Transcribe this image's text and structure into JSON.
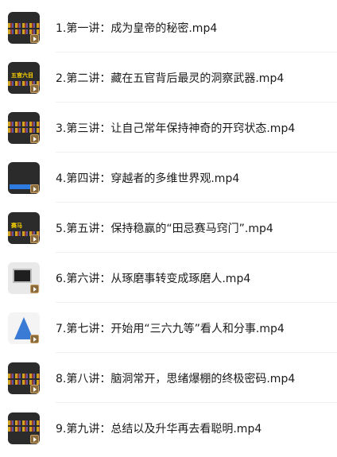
{
  "files": [
    {
      "name": "1.第一讲：成为皇帝的秘密.mp4",
      "thumb_icon": "video-thumbnail-icon",
      "thumb_caption": ""
    },
    {
      "name": "2.第二讲：藏在五官背后最灵的洞察武器.mp4",
      "thumb_icon": "video-thumbnail-icon",
      "thumb_caption": "五官六目"
    },
    {
      "name": "3.第三讲：让自己常年保持神奇的开窍状态.mp4",
      "thumb_icon": "video-thumbnail-icon",
      "thumb_caption": ""
    },
    {
      "name": "4.第四讲：穿越者的多维世界观.mp4",
      "thumb_icon": "video-thumbnail-icon",
      "thumb_caption": ""
    },
    {
      "name": "5.第五讲：保持稳赢的“田忌赛马窍门”.mp4",
      "thumb_icon": "video-thumbnail-icon",
      "thumb_caption": "赛马"
    },
    {
      "name": "6.第六讲：从琢磨事转变成琢磨人.mp4",
      "thumb_icon": "video-thumbnail-icon",
      "thumb_caption": ""
    },
    {
      "name": "7.第七讲：开始用“三六九等”看人和分事.mp4",
      "thumb_icon": "video-thumbnail-icon",
      "thumb_caption": ""
    },
    {
      "name": "8.第八讲：脑洞常开，思绪爆棚的终极密码.mp4",
      "thumb_icon": "video-thumbnail-icon",
      "thumb_caption": ""
    },
    {
      "name": "9.第九讲：总结以及升华再去看聪明.mp4",
      "thumb_icon": "video-thumbnail-icon",
      "thumb_caption": ""
    }
  ],
  "colors": {
    "text": "#1a1a1a",
    "divider": "#f0f0f2",
    "thumb_dark": "#2b2b2b",
    "accent_yellow": "#ffd500",
    "accent_blue": "#3a7bd5"
  }
}
